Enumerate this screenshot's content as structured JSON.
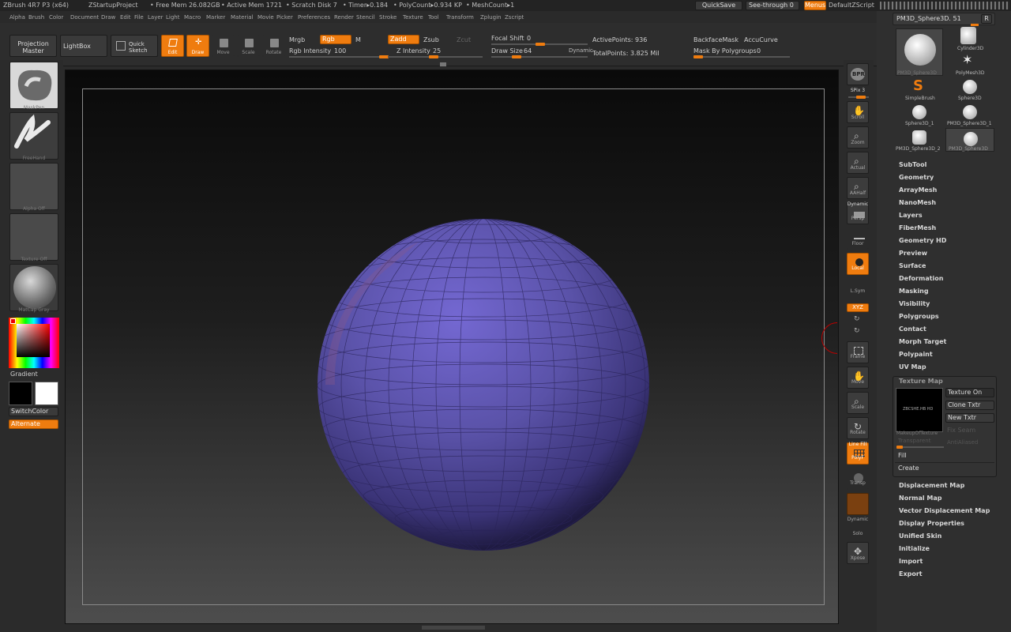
{
  "titlebar": {
    "app": "ZBrush 4R7 P3 (x64)",
    "project": "ZStartupProject",
    "free_mem": "• Free Mem 26.082GB",
    "active_mem": "• Active Mem 1721",
    "scratch": "• Scratch Disk 7",
    "timer": "• Timer▸0.184",
    "polycount": "• PolyCount▸0.934 KP",
    "meshcount": "• MeshCount▸1",
    "quicksave": "QuickSave",
    "seethrough": "See-through",
    "seethrough_val": "0",
    "menus": "Menus",
    "zscript": "DefaultZScript"
  },
  "menubar": [
    "Alpha",
    "Brush",
    "Color",
    "Document",
    "Draw",
    "Edit",
    "File",
    "Layer",
    "Light",
    "Macro",
    "Marker",
    "Material",
    "Movie",
    "Picker",
    "Preferences",
    "Render",
    "Stencil",
    "Stroke",
    "Texture",
    "Tool",
    "Transform",
    "Zplugin",
    "Zscript"
  ],
  "toolbar": {
    "projection_master": "Projection Master",
    "lightbox": "LightBox",
    "quick_sketch": "Quick Sketch",
    "edit": "Edit",
    "draw": "Draw",
    "move": "Move",
    "scale": "Scale",
    "rotate": "Rotate",
    "mrgb": "Mrgb",
    "rgb": "Rgb",
    "m": "M",
    "rgb_intensity": "Rgb Intensity",
    "rgb_intensity_val": "100",
    "zadd": "Zadd",
    "zsub": "Zsub",
    "zcut": "Zcut",
    "z_intensity": "Z Intensity",
    "z_intensity_val": "25",
    "focal_shift": "Focal Shift",
    "focal_shift_val": "0",
    "draw_size": "Draw Size",
    "draw_size_val": "64",
    "dynamic": "Dynamic",
    "active_points": "ActivePoints: 936",
    "total_points": "TotalPoints: 3.825 Mil",
    "backface_mask": "BackfaceMask",
    "accucurve": "AccuCurve",
    "mask_by_polygroups": "Mask By Polygroups",
    "mask_by_polygroups_val": "0"
  },
  "leftshelf": {
    "brush_caption": "MaskPen",
    "stroke_caption": "FreeHand",
    "alpha_caption": "Alpha Off",
    "texture_caption": "Texture Off",
    "material_caption": "MatCap Gray",
    "gradient": "Gradient",
    "switchcolor": "SwitchColor",
    "alternate": "Alternate"
  },
  "rightshelf": [
    {
      "name": "bpr",
      "label": "BPR"
    },
    {
      "name": "spix",
      "label": "SPix 3"
    },
    {
      "name": "scroll",
      "label": "Scroll"
    },
    {
      "name": "zoom",
      "label": "Zoom"
    },
    {
      "name": "actual",
      "label": "Actual"
    },
    {
      "name": "aahalf",
      "label": "AAHalf"
    },
    {
      "name": "dynamic",
      "label": "Dynamic"
    },
    {
      "name": "persp",
      "label": "Persp"
    },
    {
      "name": "floor",
      "label": "Floor"
    },
    {
      "name": "local",
      "label": "Local"
    },
    {
      "name": "lsym",
      "label": "L.Sym"
    },
    {
      "name": "xyz",
      "label": "XYZ"
    },
    {
      "name": "frame",
      "label": "Frame"
    },
    {
      "name": "move",
      "label": "Move"
    },
    {
      "name": "scale",
      "label": "Scale"
    },
    {
      "name": "rotate",
      "label": "Rotate"
    },
    {
      "name": "linefill",
      "label": "Line Fill"
    },
    {
      "name": "polyf",
      "label": "PolyF"
    },
    {
      "name": "transp",
      "label": "Transp"
    },
    {
      "name": "dynamic2",
      "label": "Dynamic"
    },
    {
      "name": "solo",
      "label": "Solo"
    },
    {
      "name": "xpose",
      "label": "Xpose"
    }
  ],
  "tool_panel": {
    "current_tool": "PM3D_Sphere3D. 51",
    "r_button": "R",
    "tools": [
      {
        "label": "PM3D_Sphere3D"
      },
      {
        "label": "Cylinder3D"
      },
      {
        "label": "PolyMesh3D"
      },
      {
        "label": "SimpleBrush"
      },
      {
        "label": "Sphere3D"
      },
      {
        "label": "Sphere3D_1"
      },
      {
        "label": "PM3D_Sphere3D_1"
      },
      {
        "label": "PM3D_Sphere3D_2"
      },
      {
        "label": "PM3D_Sphere3D"
      }
    ],
    "menus": [
      "SubTool",
      "Geometry",
      "ArrayMesh",
      "NanoMesh",
      "Layers",
      "FiberMesh",
      "Geometry HD",
      "Preview",
      "Surface",
      "Deformation",
      "Masking",
      "Visibility",
      "Polygroups",
      "Contact",
      "Morph Target",
      "Polypaint",
      "UV Map"
    ],
    "texture_map": {
      "title": "Texture Map",
      "texture_on": "Texture On",
      "clone_txtr": "Clone Txtr",
      "new_txtr": "New Txtr",
      "fix_seam": "Fix Seam",
      "antialiased": "AntiAliased",
      "transparent": "Transparent",
      "thumb_caption": "MakeupOfTexture",
      "fill": "Fill",
      "create": "Create"
    },
    "menus2": [
      "Displacement Map",
      "Normal Map",
      "Vector Displacement Map",
      "Display Properties",
      "Unified Skin",
      "Initialize",
      "Import",
      "Export"
    ]
  },
  "colors": {
    "accent": "#ef7c0f",
    "sphere": "#5a52a8"
  }
}
